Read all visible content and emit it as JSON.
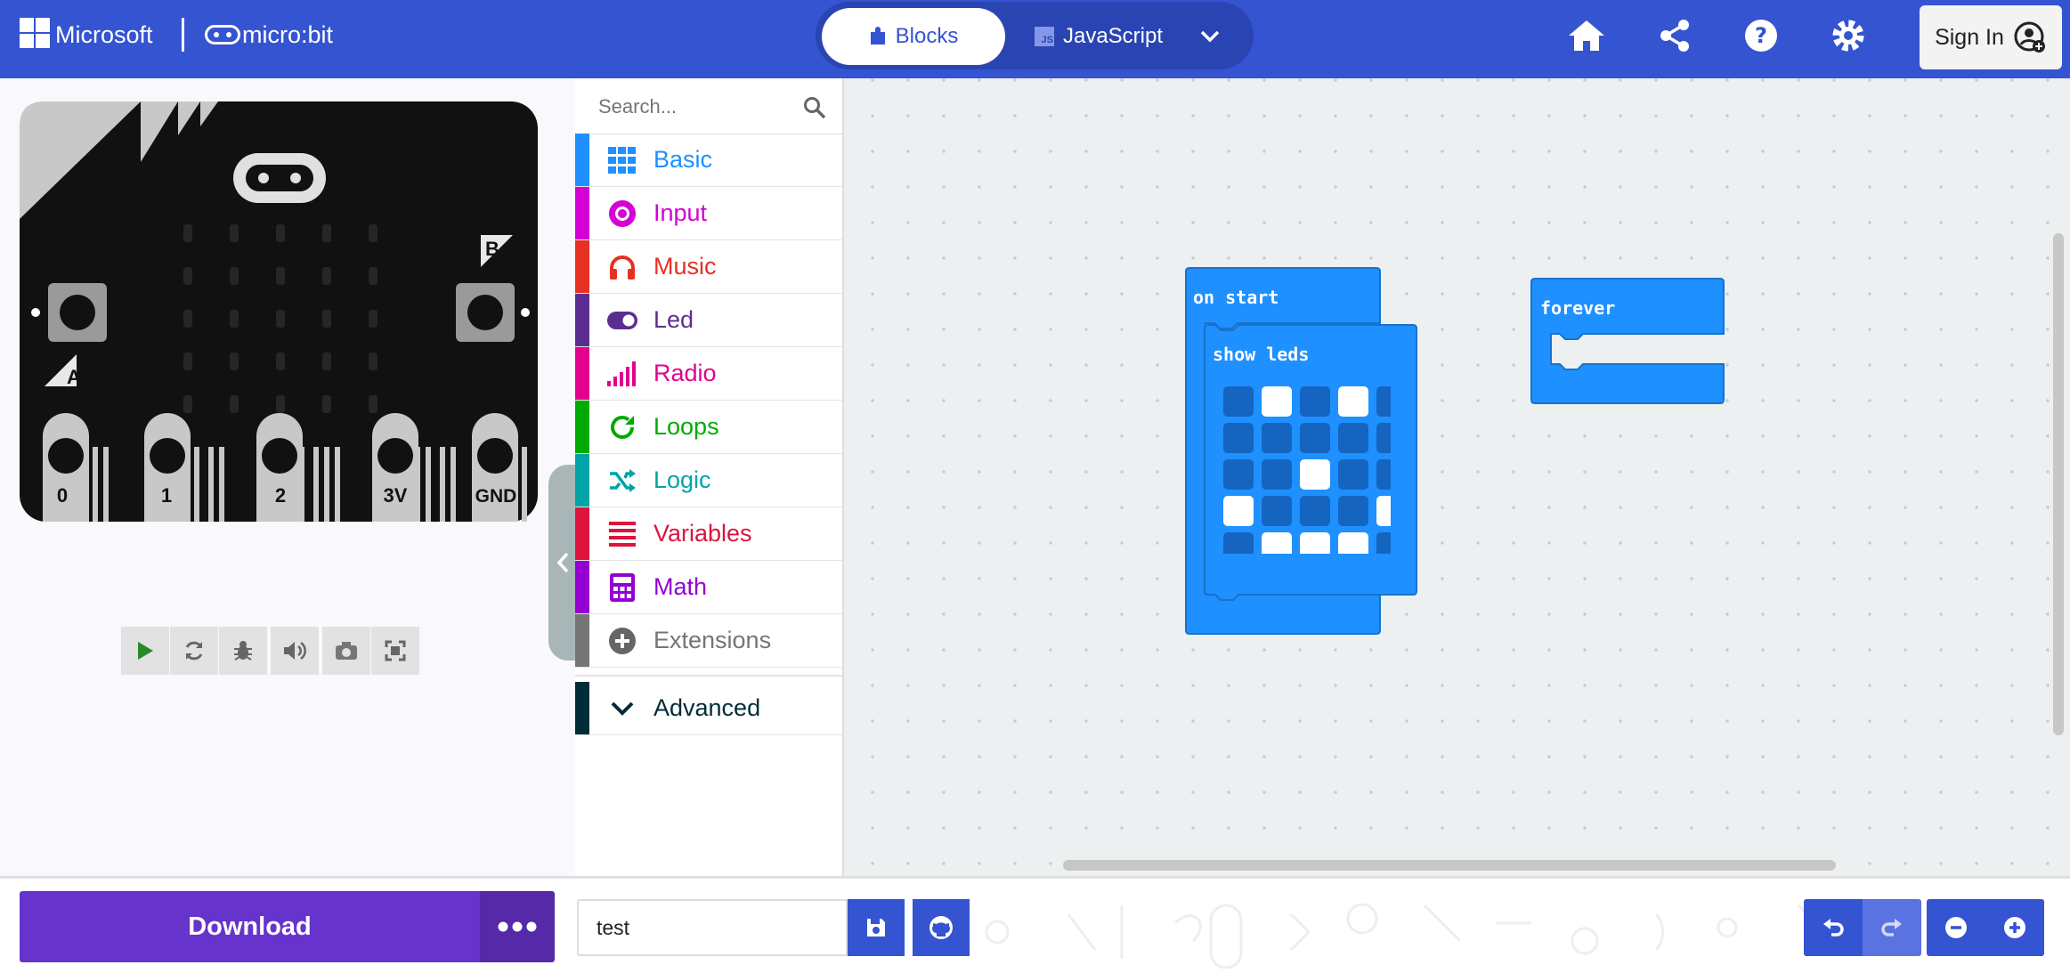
{
  "header": {
    "microsoft_label": "Microsoft",
    "microbit_label": "micro:bit",
    "tabs": {
      "blocks": "Blocks",
      "javascript": "JavaScript",
      "js_badge": "JS"
    },
    "sign_in": "Sign In",
    "icons": [
      "home-icon",
      "share-icon",
      "help-icon",
      "settings-icon"
    ]
  },
  "simulator": {
    "pins": [
      "0",
      "1",
      "2",
      "3V",
      "GND"
    ],
    "button_a": "A",
    "button_b": "B",
    "controls": [
      "play-icon",
      "restart-icon",
      "debug-icon",
      "sound-icon",
      "screenshot-icon",
      "fullscreen-icon"
    ]
  },
  "toolbox": {
    "search_placeholder": "Search...",
    "categories": [
      {
        "label": "Basic",
        "color": "#1e90ff"
      },
      {
        "label": "Input",
        "color": "#d400d4"
      },
      {
        "label": "Music",
        "color": "#e63022"
      },
      {
        "label": "Led",
        "color": "#5c2d91"
      },
      {
        "label": "Radio",
        "color": "#e3008c"
      },
      {
        "label": "Loops",
        "color": "#00aa00"
      },
      {
        "label": "Logic",
        "color": "#00a4a6"
      },
      {
        "label": "Variables",
        "color": "#dc143c"
      },
      {
        "label": "Math",
        "color": "#9400d3"
      },
      {
        "label": "Extensions",
        "color": "#757575"
      }
    ],
    "advanced_label": "Advanced",
    "advanced_color": "#002c38"
  },
  "workspace": {
    "block_color": "#1e90ff",
    "on_start_label": "on start",
    "show_leds_label": "show leds",
    "forever_label": "forever",
    "led_grid": [
      [
        0,
        1,
        0,
        1,
        0
      ],
      [
        0,
        0,
        0,
        0,
        0
      ],
      [
        0,
        0,
        1,
        0,
        0
      ],
      [
        1,
        0,
        0,
        0,
        1
      ],
      [
        0,
        1,
        1,
        1,
        0
      ]
    ]
  },
  "bottom": {
    "download_label": "Download",
    "project_name": "test"
  }
}
